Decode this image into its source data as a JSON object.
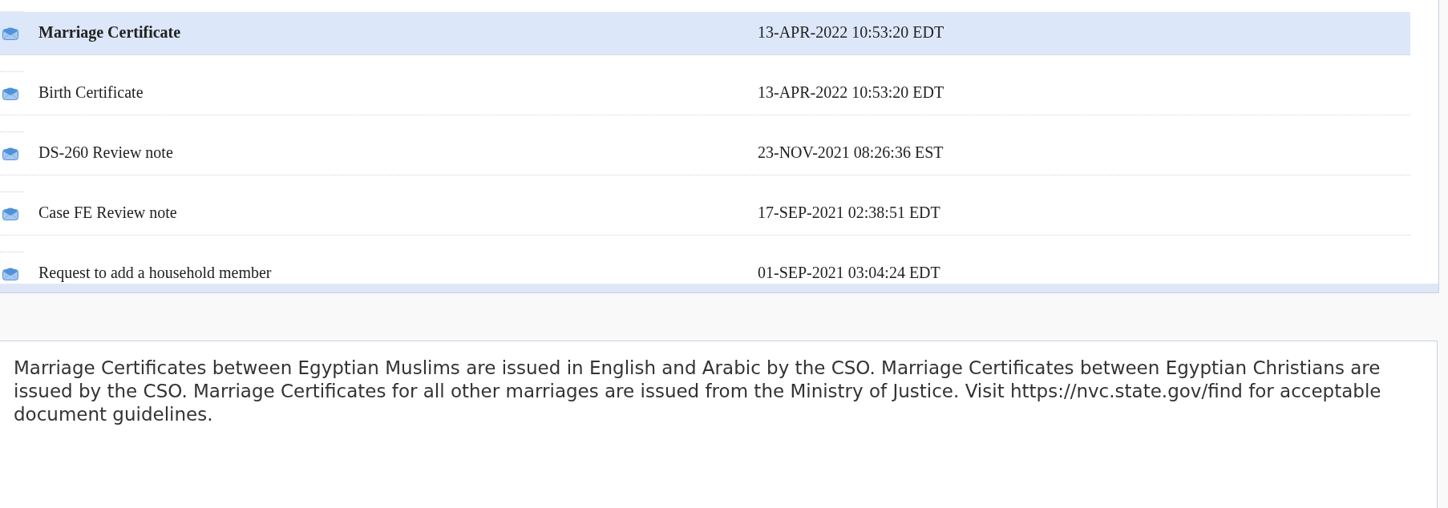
{
  "messages": [
    {
      "subject": "Marriage Certificate",
      "date": "13-APR-2022 10:53:20 EDT",
      "selected": true
    },
    {
      "subject": "Birth Certificate",
      "date": "13-APR-2022 10:53:20 EDT",
      "selected": false
    },
    {
      "subject": "DS-260 Review note",
      "date": "23-NOV-2021 08:26:36 EST",
      "selected": false
    },
    {
      "subject": "Case FE Review note",
      "date": "17-SEP-2021 02:38:51 EDT",
      "selected": false
    },
    {
      "subject": "Request to add a household member",
      "date": "01-SEP-2021 03:04:24 EDT",
      "selected": false
    }
  ],
  "message_body": {
    "text": "Marriage Certificates between Egyptian Muslims are issued in English and Arabic by the CSO. Marriage Certificates between Egyptian Christians are issued by the CSO. Marriage Certificates for all other marriages are issued from the Ministry of Justice. Visit https://nvc.state.gov/find for acceptable document guidelines."
  }
}
